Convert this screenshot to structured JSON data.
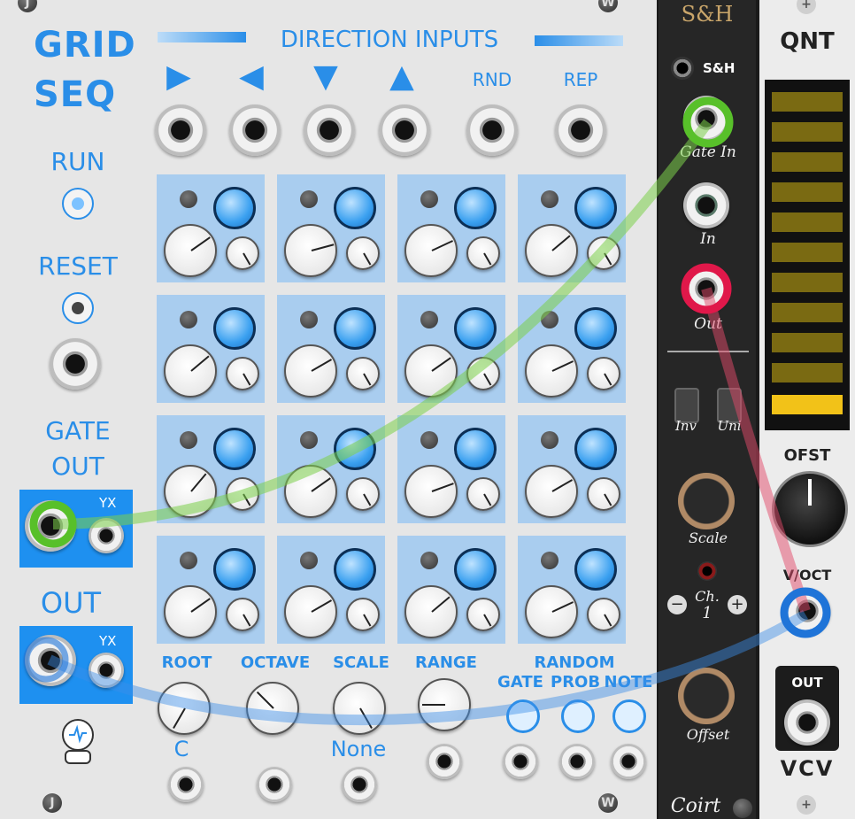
{
  "grid_seq": {
    "title_line1": "GRID",
    "title_line2": "SEQ",
    "direction_inputs": "DIRECTION INPUTS",
    "arrows": [
      "▶",
      "◀",
      "▼",
      "▲"
    ],
    "rnd": "RND",
    "rep": "REP",
    "run": "RUN",
    "reset": "RESET",
    "gate_out_line1": "GATE",
    "gate_out_line2": "OUT",
    "out": "OUT",
    "yx_gate": "YX",
    "yx_out": "YX",
    "root": "ROOT",
    "octave": "OCTAVE",
    "scale": "SCALE",
    "range": "RANGE",
    "random": "RANDOM",
    "gate": "GATE",
    "prob": "PROB",
    "note": "NOTE",
    "root_value": "C",
    "scale_value": "None",
    "screw_j": "J",
    "screw_w": "W",
    "colors": {
      "accent": "#2a8ee8",
      "panel": "#e6e6e6",
      "cell": "#a9cdef"
    }
  },
  "sample_hold": {
    "title": "S&H",
    "sh_label": "S&H",
    "gate_in": "Gate In",
    "in": "In",
    "out": "Out",
    "inv": "Inv",
    "uni": "Uni",
    "scale": "Scale",
    "ch": "Ch.",
    "ch_value": "1",
    "minus": "−",
    "plus": "+",
    "offset": "Offset",
    "brand": "Coirt"
  },
  "qnt": {
    "title": "QNT",
    "ofst": "OFST",
    "voct": "V/OCT",
    "out": "OUT",
    "brand": "VCV",
    "plus": "+"
  }
}
